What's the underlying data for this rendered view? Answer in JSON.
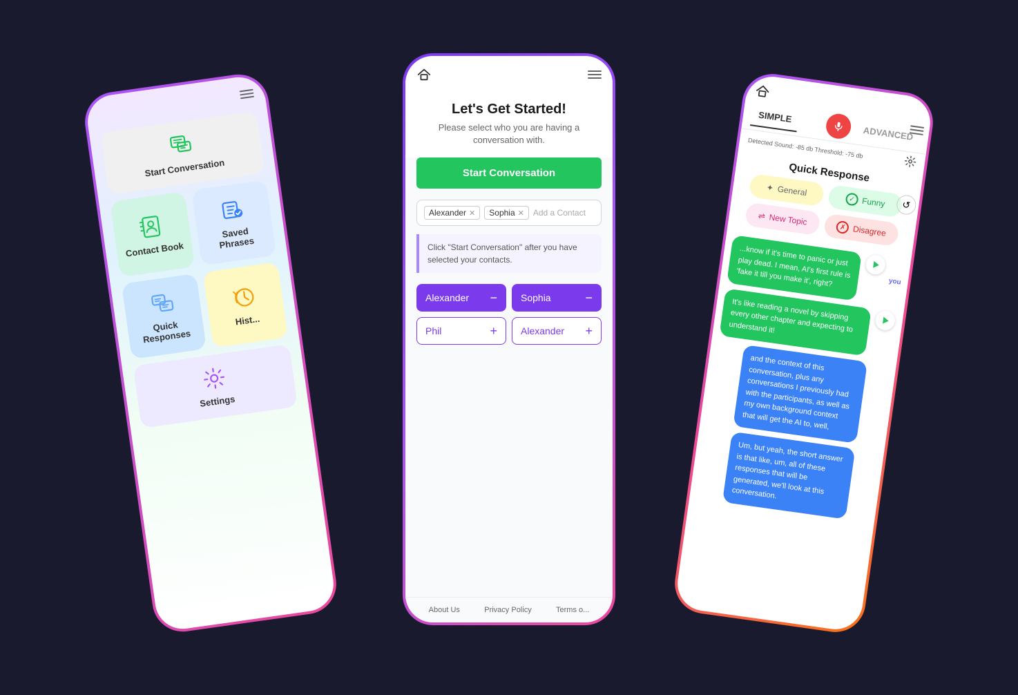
{
  "left_phone": {
    "menu_label": "menu",
    "items": [
      {
        "id": "start-conversation",
        "label": "Start\nConversation",
        "color": "#f0f0f0",
        "icon": "chat"
      },
      {
        "id": "contact-book",
        "label": "Contact Book",
        "color": "#d1f5e4",
        "icon": "contact"
      },
      {
        "id": "saved-phrases",
        "label": "Saved Phrases",
        "color": "#dbeafe",
        "icon": "saved"
      },
      {
        "id": "quick-responses",
        "label": "Quick\nResponses",
        "color": "#cce5ff",
        "icon": "quick"
      },
      {
        "id": "history",
        "label": "Hist...",
        "color": "#fef9c3",
        "icon": "history"
      },
      {
        "id": "settings",
        "label": "Settings",
        "color": "#ede9fe",
        "icon": "settings"
      }
    ]
  },
  "middle_phone": {
    "title": "Let's Get Started!",
    "subtitle": "Please select who you are having a conversation with.",
    "start_btn": "Start Conversation",
    "contacts_selected": [
      "Alexander",
      "Sophia"
    ],
    "add_placeholder": "Add a Contact",
    "hint_text": "Click \"Start Conversation\" after you have selected your contacts.",
    "contact_list": [
      {
        "name": "Alexander",
        "selected": true
      },
      {
        "name": "Sophia",
        "selected": true
      },
      {
        "name": "Phil",
        "selected": false
      },
      {
        "name": "Alexander",
        "selected": false
      }
    ],
    "footer": [
      "About Us",
      "Privacy Policy",
      "Terms o..."
    ]
  },
  "right_phone": {
    "tabs": [
      "SIMPLE",
      "ADVANCED"
    ],
    "active_tab": "SIMPLE",
    "sound_info": "Detected Sound: -85 db  Threshold: -75 db",
    "title": "Quick Response",
    "response_btns": [
      {
        "id": "general",
        "label": "General",
        "icon": "✦"
      },
      {
        "id": "funny",
        "label": "Funny",
        "icon": "✓"
      },
      {
        "id": "new-topic",
        "label": "New Topic",
        "icon": "⇌"
      },
      {
        "id": "disagree",
        "label": "Disagree",
        "icon": "✗"
      }
    ],
    "you_label": "you",
    "messages": [
      {
        "side": "left",
        "text": "...know if it's time to panic or just play dead. I mean, AI's first rule is 'fake it till you make it', right?"
      },
      {
        "side": "left",
        "text": "It's like reading a novel by skipping every other chapter and expecting to understand it!"
      },
      {
        "side": "right",
        "text": "and the context of this conversation, plus any conversations I previously had with the participants, as well as my own background context that will get the AI to, well,"
      },
      {
        "side": "right",
        "text": "Um, but yeah, the short answer is that like, um, all of these responses that will be generated, we'll look at this conversation."
      }
    ]
  }
}
